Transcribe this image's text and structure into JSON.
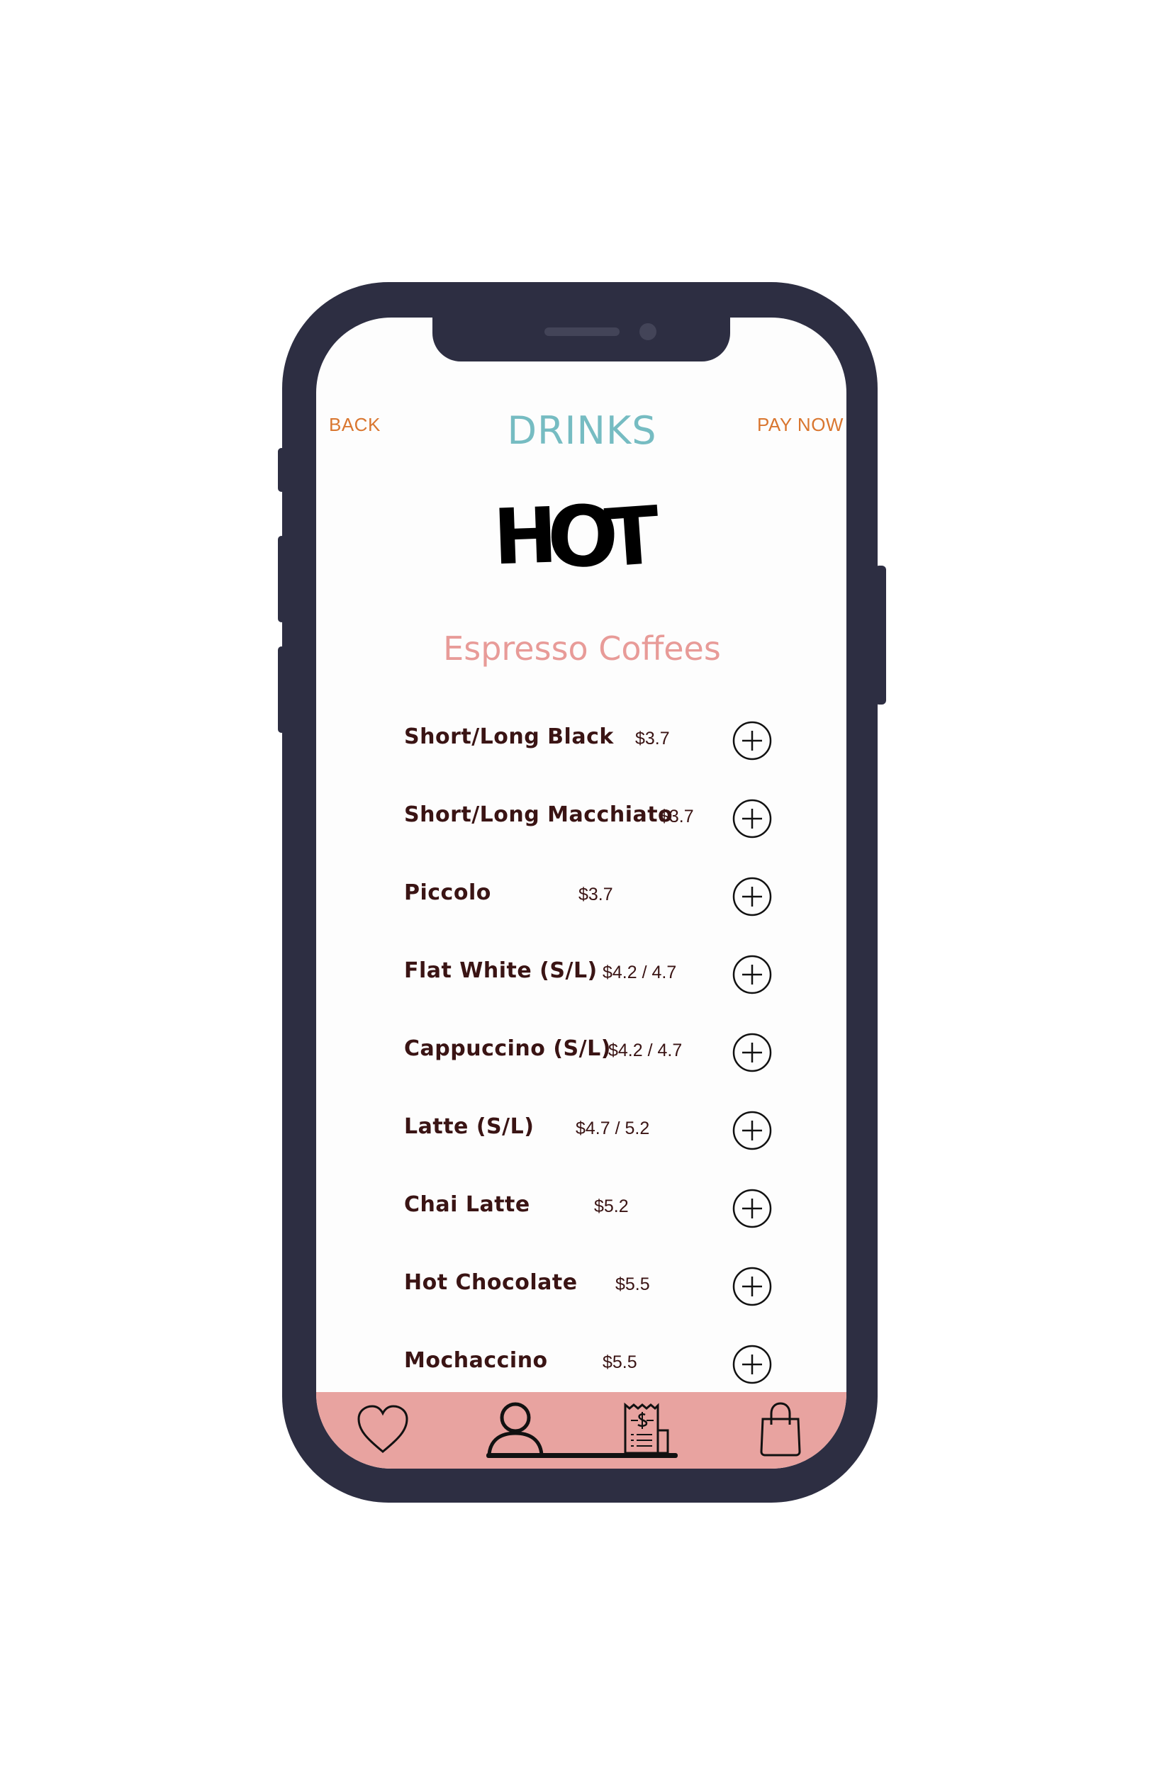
{
  "header": {
    "back_label": "BACK",
    "title": "DRINKS",
    "pay_label": "PAY NOW"
  },
  "hero": {
    "letters": [
      "H",
      "O",
      "T"
    ]
  },
  "section": {
    "title": "Espresso Coffees"
  },
  "menu_items": [
    {
      "name": "Short/Long Black",
      "price": "$3.7"
    },
    {
      "name": "Short/Long Macchiato",
      "price": "$3.7"
    },
    {
      "name": "Piccolo",
      "price": "$3.7"
    },
    {
      "name": "Flat White (S/L)",
      "price": "$4.2 / 4.7"
    },
    {
      "name": "Cappuccino (S/L)",
      "price": "$4.2 / 4.7"
    },
    {
      "name": "Latte (S/L)",
      "price": "$4.7 / 5.2"
    },
    {
      "name": "Chai Latte",
      "price": "$5.2"
    },
    {
      "name": "Hot Chocolate",
      "price": "$5.5"
    },
    {
      "name": "Mochaccino",
      "price": "$5.5"
    }
  ],
  "tabbar": {
    "tabs": [
      {
        "icon": "heart-icon"
      },
      {
        "icon": "user-icon",
        "active": true
      },
      {
        "icon": "receipt-icon"
      },
      {
        "icon": "shopping-bag-icon"
      }
    ]
  },
  "colors": {
    "frame": "#2d2e42",
    "accent_orange": "#d9762f",
    "title_teal": "#76bcc2",
    "section_pink": "#e89b98",
    "tabbar_pink": "#e8a3a0",
    "item_text": "#3a1414"
  }
}
